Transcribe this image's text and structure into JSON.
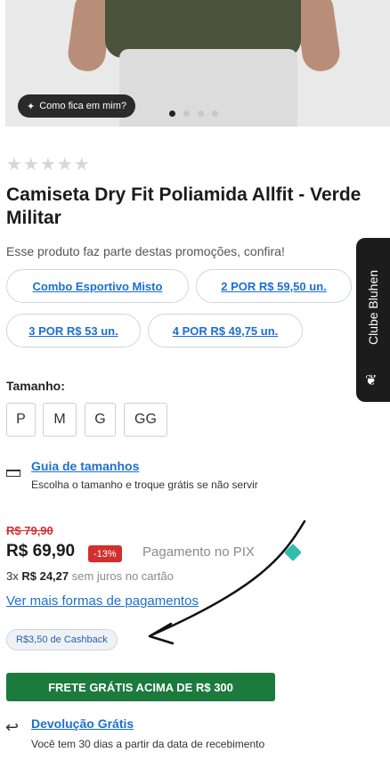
{
  "gallery": {
    "tryon_label": "Como fica em mim?",
    "dots": 4,
    "active_dot": 1
  },
  "rating": {
    "stars": "★★★★★"
  },
  "product": {
    "title": "Camiseta Dry Fit Poliamida Allfit - Verde Militar"
  },
  "promotions": {
    "intro": "Esse produto faz parte destas promoções, confira!",
    "items": [
      "Combo Esportivo Misto",
      "2 POR R$ 59,50 un.",
      "3 POR R$ 53 un.",
      "4 POR R$ 49,75 un."
    ]
  },
  "sizes": {
    "label": "Tamanho:",
    "options": [
      "P",
      "M",
      "G",
      "GG"
    ]
  },
  "size_guide": {
    "link": "Guia de tamanhos",
    "description": "Escolha o tamanho e troque grátis se não servir"
  },
  "pricing": {
    "old_price": "R$ 79,90",
    "price": "R$ 69,90",
    "discount": "-13%",
    "pix_label": "Pagamento no PIX",
    "installment_prefix": "3x",
    "installment_value": "R$ 24,27",
    "installment_suffix": "sem juros no cartão",
    "more_payment": "Ver mais formas de pagamentos",
    "cashback": "R$3,50 de Cashback"
  },
  "shipping": {
    "banner": "FRETE GRÁTIS ACIMA DE R$ 300"
  },
  "returns": {
    "link": "Devolução Grátis",
    "description": "Você tem 30 dias a partir da data de recebimento"
  },
  "club": {
    "label": "Clube Bluhen"
  },
  "colors": {
    "link_blue": "#1d6fd0",
    "price_red": "#d32f2f",
    "shipping_green": "#1c7a3c",
    "pix_teal": "#32bcad"
  }
}
